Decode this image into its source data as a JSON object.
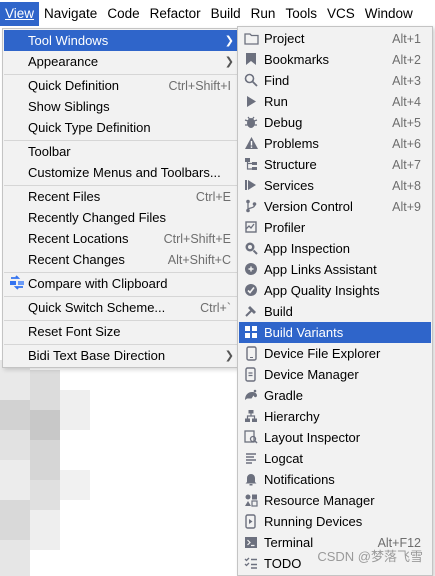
{
  "menubar": {
    "items": [
      "View",
      "Navigate",
      "Code",
      "Refactor",
      "Build",
      "Run",
      "Tools",
      "VCS",
      "Window"
    ]
  },
  "view_menu": {
    "items": [
      {
        "label": "Tool Windows",
        "shortcut": ""
      },
      {
        "label": "Appearance",
        "shortcut": ""
      },
      {
        "label": "Quick Definition",
        "shortcut": "Ctrl+Shift+I"
      },
      {
        "label": "Show Siblings",
        "shortcut": ""
      },
      {
        "label": "Quick Type Definition",
        "shortcut": ""
      },
      {
        "label": "Toolbar",
        "shortcut": ""
      },
      {
        "label": "Customize Menus and Toolbars...",
        "shortcut": ""
      },
      {
        "label": "Recent Files",
        "shortcut": "Ctrl+E"
      },
      {
        "label": "Recently Changed Files",
        "shortcut": ""
      },
      {
        "label": "Recent Locations",
        "shortcut": "Ctrl+Shift+E"
      },
      {
        "label": "Recent Changes",
        "shortcut": "Alt+Shift+C"
      },
      {
        "label": "Compare with Clipboard",
        "shortcut": ""
      },
      {
        "label": "Quick Switch Scheme...",
        "shortcut": "Ctrl+`"
      },
      {
        "label": "Reset Font Size",
        "shortcut": ""
      },
      {
        "label": "Bidi Text Base Direction",
        "shortcut": ""
      }
    ]
  },
  "tool_windows": {
    "items": [
      {
        "label": "Project",
        "shortcut": "Alt+1",
        "icon": "folder-icon"
      },
      {
        "label": "Bookmarks",
        "shortcut": "Alt+2",
        "icon": "bookmark-icon"
      },
      {
        "label": "Find",
        "shortcut": "Alt+3",
        "icon": "search-icon"
      },
      {
        "label": "Run",
        "shortcut": "Alt+4",
        "icon": "run-icon"
      },
      {
        "label": "Debug",
        "shortcut": "Alt+5",
        "icon": "bug-icon"
      },
      {
        "label": "Problems",
        "shortcut": "Alt+6",
        "icon": "warning-icon"
      },
      {
        "label": "Structure",
        "shortcut": "Alt+7",
        "icon": "structure-icon"
      },
      {
        "label": "Services",
        "shortcut": "Alt+8",
        "icon": "services-icon"
      },
      {
        "label": "Version Control",
        "shortcut": "Alt+9",
        "icon": "vcs-branch-icon"
      },
      {
        "label": "Profiler",
        "shortcut": "",
        "icon": "profiler-icon"
      },
      {
        "label": "App Inspection",
        "shortcut": "",
        "icon": "app-inspection-icon"
      },
      {
        "label": "App Links Assistant",
        "shortcut": "",
        "icon": "link-icon"
      },
      {
        "label": "App Quality Insights",
        "shortcut": "",
        "icon": "quality-insights-icon"
      },
      {
        "label": "Build",
        "shortcut": "",
        "icon": "hammer-icon"
      },
      {
        "label": "Build Variants",
        "shortcut": "",
        "icon": "build-variants-icon"
      },
      {
        "label": "Device File Explorer",
        "shortcut": "",
        "icon": "device-icon"
      },
      {
        "label": "Device Manager",
        "shortcut": "",
        "icon": "device-manager-icon"
      },
      {
        "label": "Gradle",
        "shortcut": "",
        "icon": "gradle-icon"
      },
      {
        "label": "Hierarchy",
        "shortcut": "",
        "icon": "hierarchy-icon"
      },
      {
        "label": "Layout Inspector",
        "shortcut": "",
        "icon": "layout-inspector-icon"
      },
      {
        "label": "Logcat",
        "shortcut": "",
        "icon": "logcat-icon"
      },
      {
        "label": "Notifications",
        "shortcut": "",
        "icon": "bell-icon"
      },
      {
        "label": "Resource Manager",
        "shortcut": "",
        "icon": "resource-manager-icon"
      },
      {
        "label": "Running Devices",
        "shortcut": "",
        "icon": "running-devices-icon"
      },
      {
        "label": "Terminal",
        "shortcut": "Alt+F12",
        "icon": "terminal-icon"
      },
      {
        "label": "TODO",
        "shortcut": "",
        "icon": "todo-icon"
      }
    ]
  },
  "watermark": "CSDN @梦落飞雪",
  "colors": {
    "accent": "#2f65ca",
    "menu_bg": "#f2f2f2"
  }
}
